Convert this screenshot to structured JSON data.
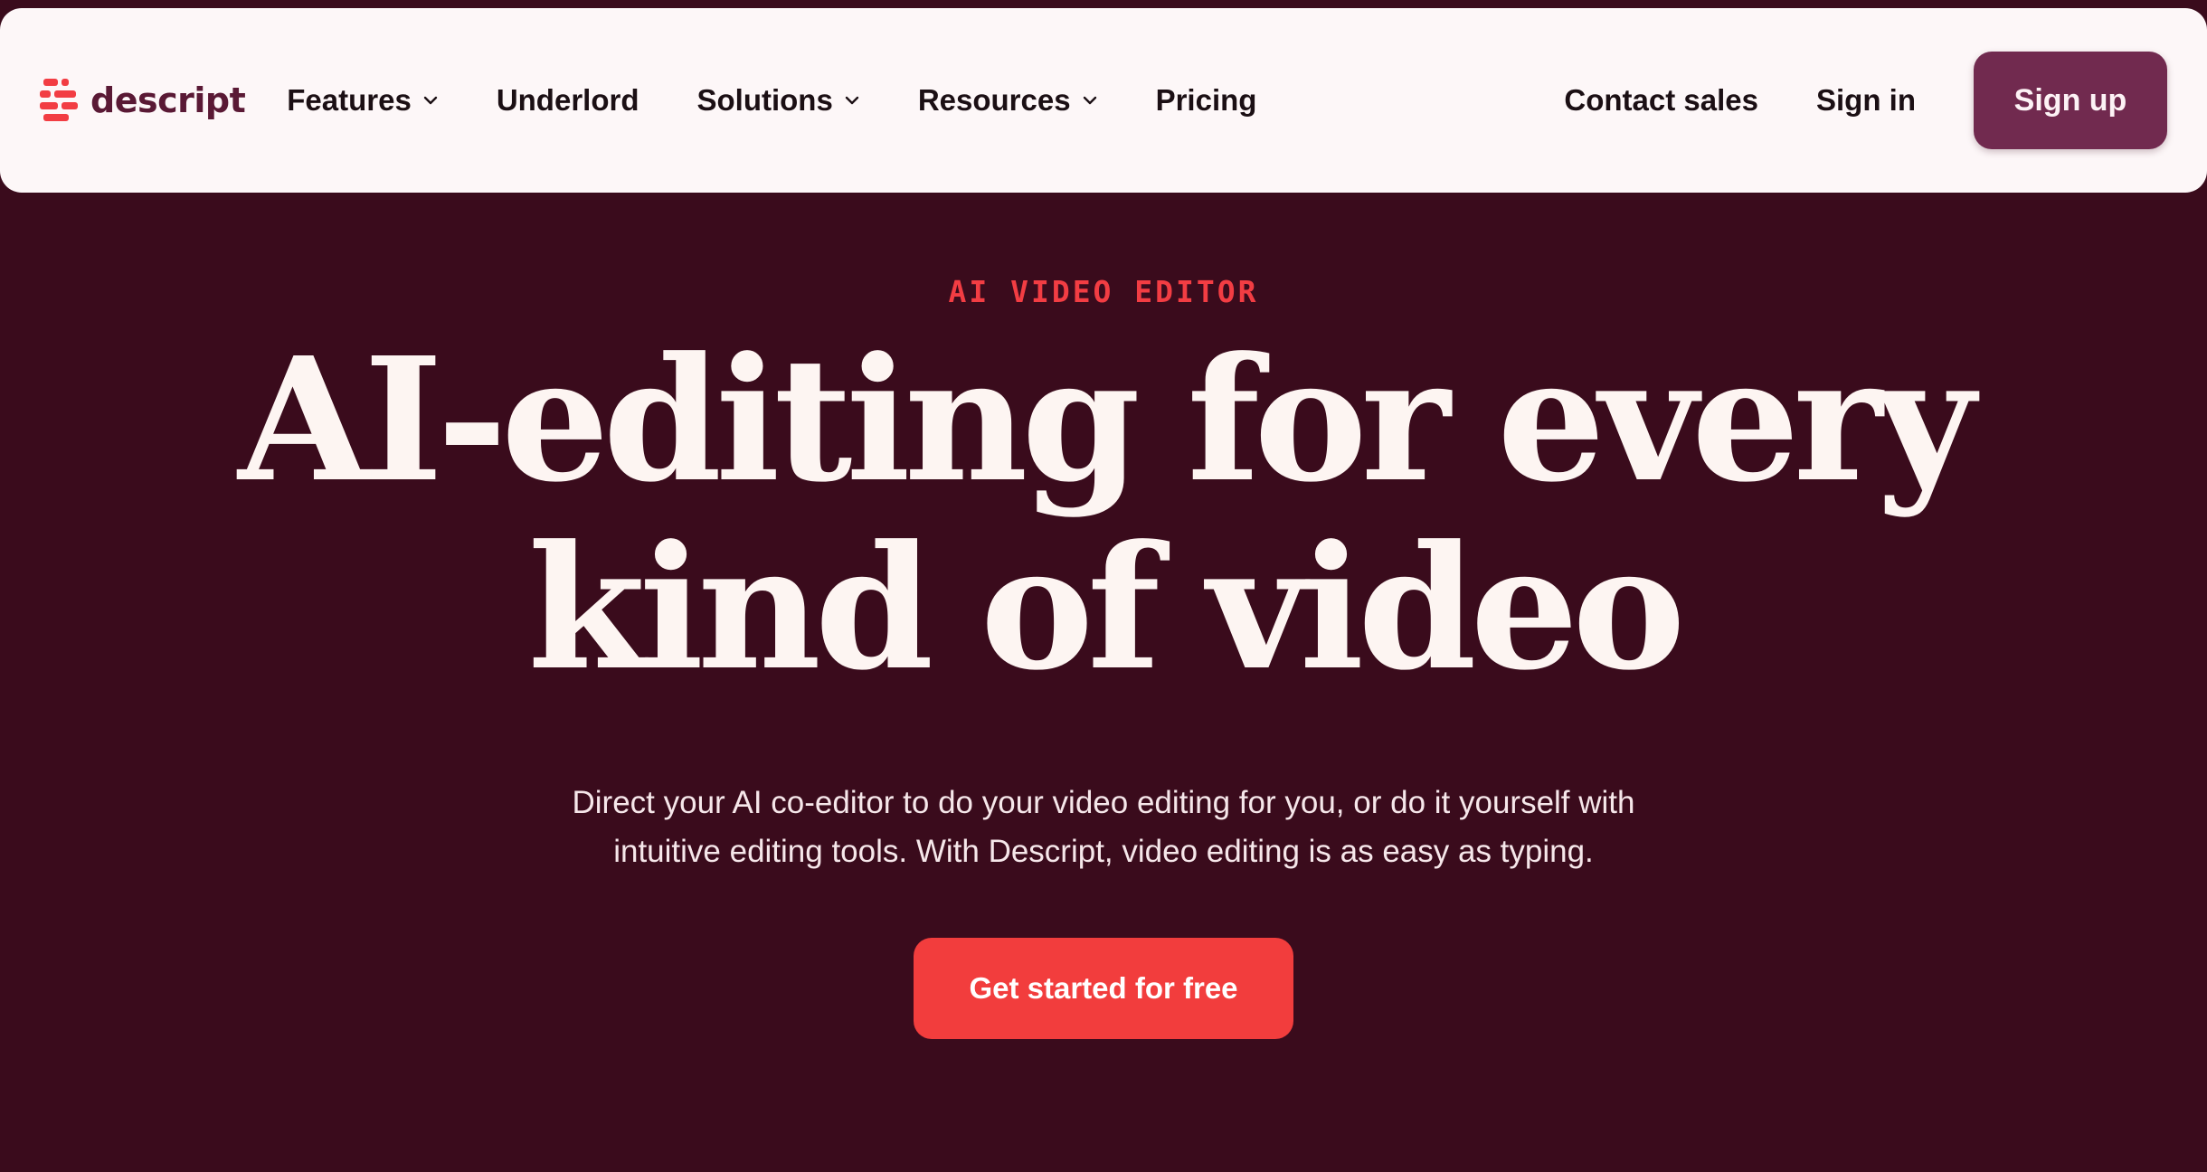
{
  "brand": {
    "name": "descript",
    "logo_icon": "descript-logo-icon",
    "colors": {
      "logo_red": "#f23d43",
      "logo_text": "#5a1935",
      "background": "#3a0b1c",
      "nav_background": "#fdf7f8",
      "signup_button": "#712a4f",
      "cta_button": "#f23d3d"
    }
  },
  "nav": {
    "items": [
      {
        "label": "Features",
        "has_dropdown": true
      },
      {
        "label": "Underlord",
        "has_dropdown": false
      },
      {
        "label": "Solutions",
        "has_dropdown": true
      },
      {
        "label": "Resources",
        "has_dropdown": true
      },
      {
        "label": "Pricing",
        "has_dropdown": false
      }
    ],
    "contact_sales": "Contact sales",
    "sign_in": "Sign in",
    "sign_up": "Sign up"
  },
  "hero": {
    "eyebrow": "AI VIDEO EDITOR",
    "headline_line1": "AI-editing for every",
    "headline_line2": "kind of video",
    "subtext_line1": "Direct your AI co-editor to do your video editing for you, or do it yourself with",
    "subtext_line2": "intuitive editing tools. With Descript, video editing is as easy as typing.",
    "cta": "Get started for free"
  }
}
